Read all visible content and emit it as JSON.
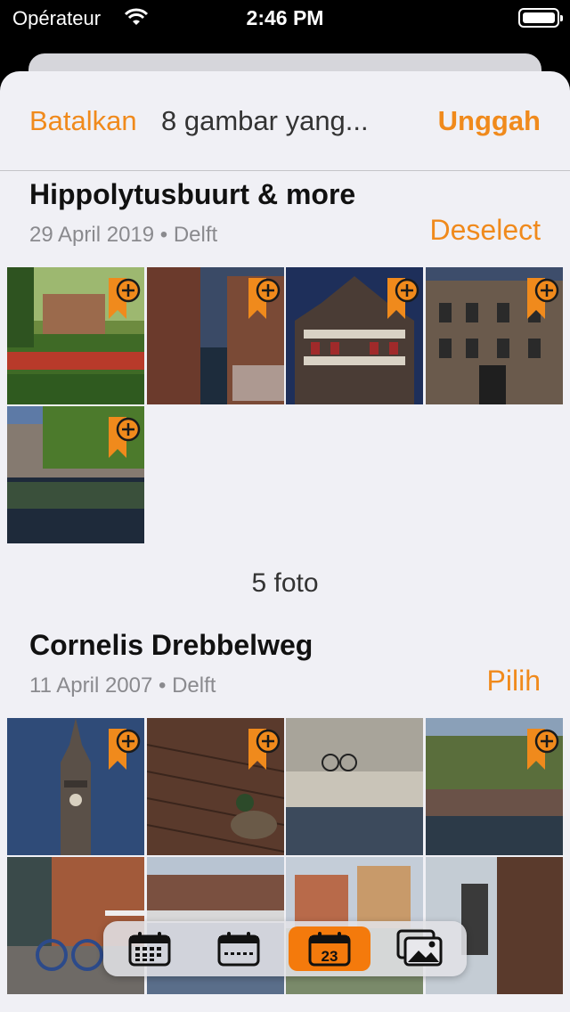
{
  "status_bar": {
    "carrier": "Opérateur",
    "time": "2:46 PM"
  },
  "navbar": {
    "cancel_label": "Batalkan",
    "title": "8 gambar yang...",
    "upload_label": "Unggah"
  },
  "sections": [
    {
      "title": "Hippolytusbuurt & more",
      "subtitle": "29 April 2019 • Delft",
      "action_label": "Deselect",
      "count_label": "5 foto",
      "photos": [
        {
          "scene": "garden",
          "badge": true
        },
        {
          "scene": "canal-alley",
          "badge": true
        },
        {
          "scene": "town-hall",
          "badge": true
        },
        {
          "scene": "facade",
          "badge": true
        },
        {
          "scene": "canal-street",
          "badge": true
        }
      ]
    },
    {
      "title": "Cornelis Drebbelweg",
      "subtitle": "11 April 2007 • Delft",
      "action_label": "Pilih",
      "photos": [
        {
          "scene": "church-tower",
          "badge": true
        },
        {
          "scene": "duck-bricks",
          "badge": true
        },
        {
          "scene": "canal-bikes",
          "badge": false
        },
        {
          "scene": "canal-trees",
          "badge": true
        },
        {
          "scene": "bicycle-bridge",
          "badge": false
        },
        {
          "scene": "canal-bridge",
          "badge": false
        },
        {
          "scene": "houses-square",
          "badge": false
        },
        {
          "scene": "church-wall",
          "badge": false
        }
      ]
    }
  ],
  "toolbar": {
    "tabs": [
      {
        "name": "year",
        "icon": "calendar-grid-icon",
        "active": false
      },
      {
        "name": "month",
        "icon": "calendar-dots-icon",
        "active": false
      },
      {
        "name": "day",
        "icon": "calendar-day-icon",
        "label": "23",
        "active": true
      },
      {
        "name": "all",
        "icon": "photos-icon",
        "active": false
      }
    ]
  },
  "colors": {
    "accent": "#f08a1c",
    "active_tab": "#f47a0c",
    "background": "#f0f0f5"
  }
}
